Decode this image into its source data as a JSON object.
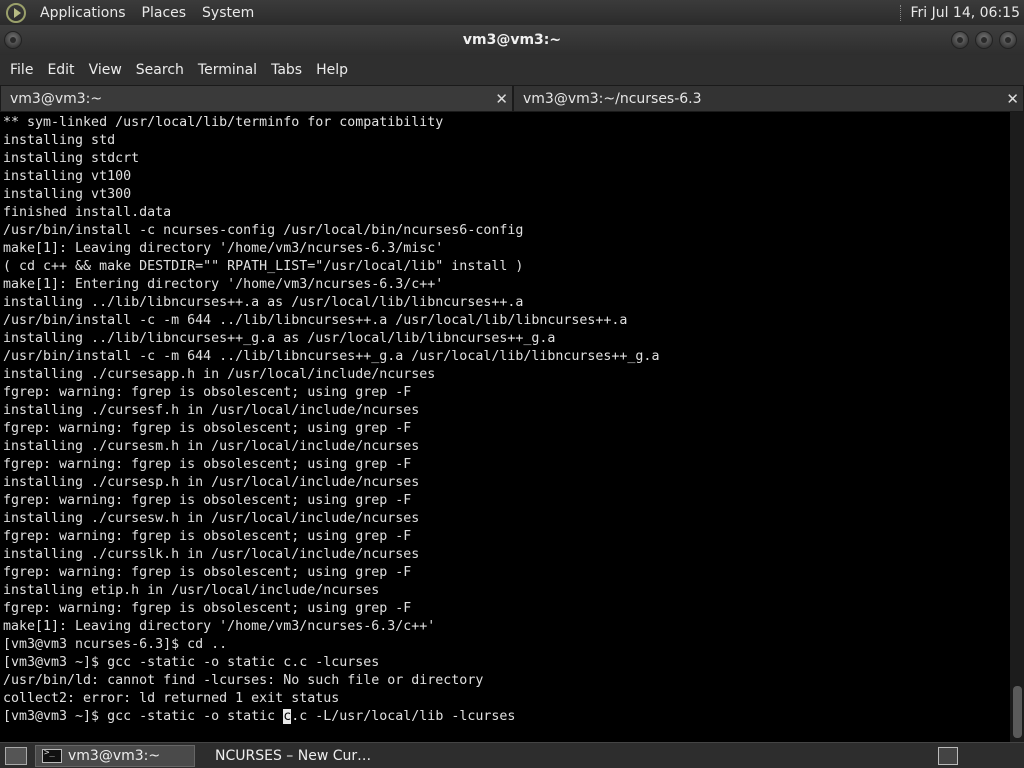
{
  "top_panel": {
    "menus": [
      "Applications",
      "Places",
      "System"
    ],
    "clock": "Fri Jul 14, 06:15"
  },
  "window": {
    "title": "vm3@vm3:~"
  },
  "menubar": {
    "items": [
      "File",
      "Edit",
      "View",
      "Search",
      "Terminal",
      "Tabs",
      "Help"
    ]
  },
  "tabs": [
    {
      "label": "vm3@vm3:~",
      "close": "✕"
    },
    {
      "label": "vm3@vm3:~/ncurses-6.3",
      "close": "✕"
    }
  ],
  "terminal": {
    "lines": [
      "** sym-linked /usr/local/lib/terminfo for compatibility",
      "installing std",
      "installing stdcrt",
      "installing vt100",
      "installing vt300",
      "finished install.data",
      "/usr/bin/install -c ncurses-config /usr/local/bin/ncurses6-config",
      "make[1]: Leaving directory '/home/vm3/ncurses-6.3/misc'",
      "( cd c++ && make DESTDIR=\"\" RPATH_LIST=\"/usr/local/lib\" install )",
      "make[1]: Entering directory '/home/vm3/ncurses-6.3/c++'",
      "installing ../lib/libncurses++.a as /usr/local/lib/libncurses++.a",
      "/usr/bin/install -c -m 644 ../lib/libncurses++.a /usr/local/lib/libncurses++.a",
      "installing ../lib/libncurses++_g.a as /usr/local/lib/libncurses++_g.a",
      "/usr/bin/install -c -m 644 ../lib/libncurses++_g.a /usr/local/lib/libncurses++_g.a",
      "installing ./cursesapp.h in /usr/local/include/ncurses",
      "fgrep: warning: fgrep is obsolescent; using grep -F",
      "installing ./cursesf.h in /usr/local/include/ncurses",
      "fgrep: warning: fgrep is obsolescent; using grep -F",
      "installing ./cursesm.h in /usr/local/include/ncurses",
      "fgrep: warning: fgrep is obsolescent; using grep -F",
      "installing ./cursesp.h in /usr/local/include/ncurses",
      "fgrep: warning: fgrep is obsolescent; using grep -F",
      "installing ./cursesw.h in /usr/local/include/ncurses",
      "fgrep: warning: fgrep is obsolescent; using grep -F",
      "installing ./cursslk.h in /usr/local/include/ncurses",
      "fgrep: warning: fgrep is obsolescent; using grep -F",
      "installing etip.h in /usr/local/include/ncurses",
      "fgrep: warning: fgrep is obsolescent; using grep -F",
      "make[1]: Leaving directory '/home/vm3/ncurses-6.3/c++'",
      "[vm3@vm3 ncurses-6.3]$ cd ..",
      "[vm3@vm3 ~]$ gcc -static -o static c.c -lcurses",
      "/usr/bin/ld: cannot find -lcurses: No such file or directory",
      "collect2: error: ld returned 1 exit status"
    ],
    "prompt_before_cursor": "[vm3@vm3 ~]$ gcc -static -o static ",
    "cursor_char": "c",
    "prompt_after_cursor": ".c -L/usr/local/lib -lcurses"
  },
  "taskbar": {
    "items": [
      {
        "label": "vm3@vm3:~",
        "icon": "terminal-icon"
      },
      {
        "label": "NCURSES – New Cur…",
        "icon": "firefox-icon"
      }
    ]
  }
}
